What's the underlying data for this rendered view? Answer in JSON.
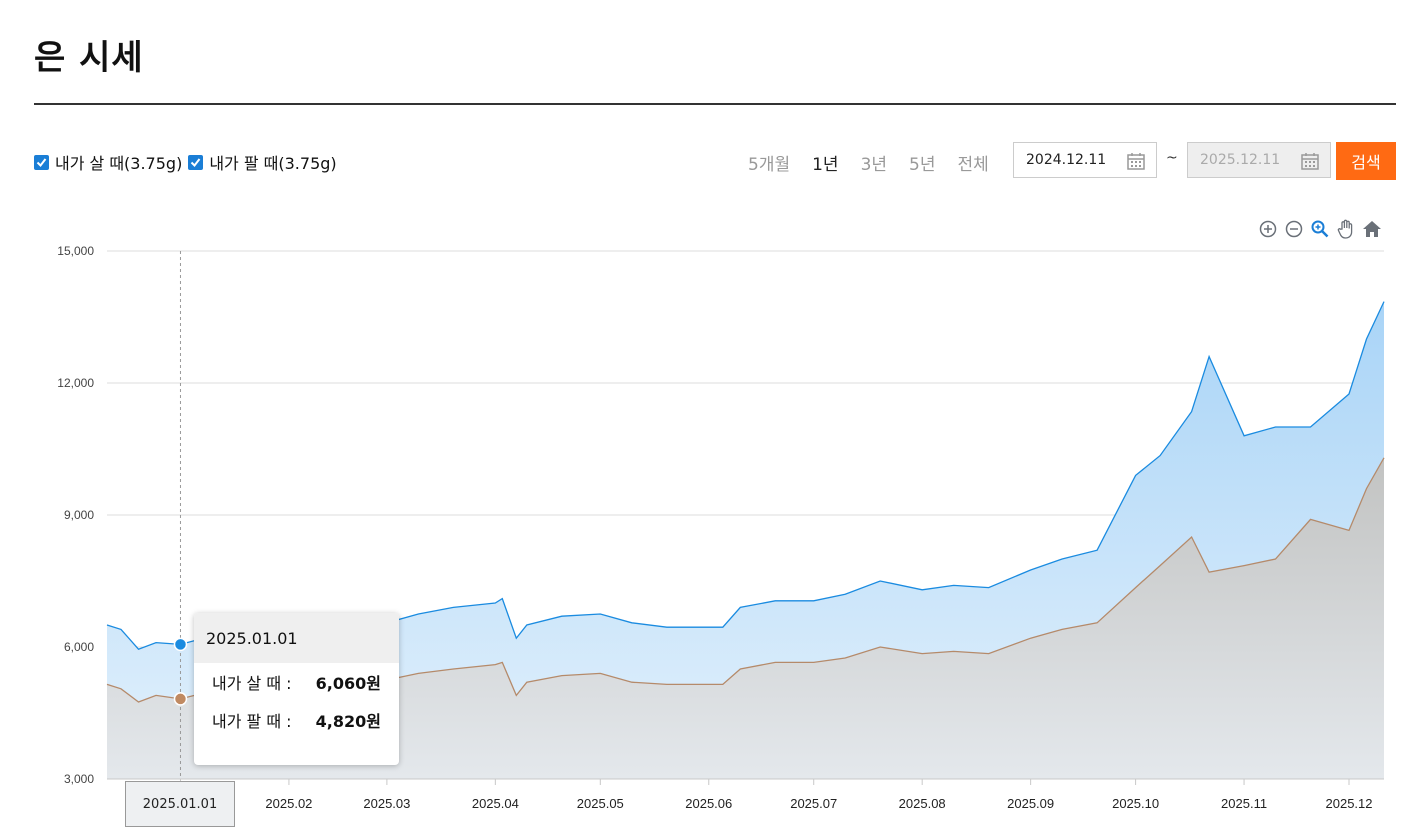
{
  "page": {
    "title": "은 시세"
  },
  "filters": {
    "checkbox_buy": "내가 살 때(3.75g)",
    "checkbox_sell": "내가 팔 때(3.75g)",
    "periods": [
      "5개월",
      "1년",
      "3년",
      "5년",
      "전체"
    ],
    "active_period": "1년",
    "date_from": "2024.12.11",
    "date_separator": "~",
    "date_to": "2025.12.11",
    "search_label": "검색"
  },
  "tooltip": {
    "date": "2025.01.01",
    "buy_label": "내가 살 때 :",
    "buy_value": "6,060원",
    "sell_label": "내가 팔 때 :",
    "sell_value": "4,820원"
  },
  "chart_data": {
    "type": "area",
    "title": "",
    "xlabel": "",
    "ylabel": "",
    "ylim": [
      3000,
      15000
    ],
    "yticks": [
      3000,
      6000,
      9000,
      12000,
      15000
    ],
    "ytick_labels": [
      "3,000",
      "6,000",
      "9,000",
      "12,000",
      "15,000"
    ],
    "xlim": [
      "2024-12-11",
      "2025-12-11"
    ],
    "xticks": [
      "2025-01-01",
      "2025-02-01",
      "2025-03-01",
      "2025-04-01",
      "2025-05-01",
      "2025-06-01",
      "2025-07-01",
      "2025-08-01",
      "2025-09-01",
      "2025-10-01",
      "2025-11-01",
      "2025-12-01"
    ],
    "xtick_labels": [
      "2025.01.01",
      "2025.02",
      "2025.03",
      "2025.04",
      "2025.05",
      "2025.06",
      "2025.07",
      "2025.08",
      "2025.09",
      "2025.10",
      "2025.11",
      "2025.12"
    ],
    "highlight_date": "2025-01-01",
    "grid": true,
    "colors": {
      "buy": "#1a8be0",
      "sell": "#b58a6a",
      "buy_fill": "#a9d4f7",
      "sell_fill": "#d9d7d4"
    },
    "series": [
      {
        "name": "내가 살 때(3.75g)",
        "x": [
          "2024-12-11",
          "2024-12-15",
          "2024-12-20",
          "2024-12-25",
          "2025-01-01",
          "2025-01-10",
          "2025-01-20",
          "2025-02-01",
          "2025-02-10",
          "2025-02-20",
          "2025-03-01",
          "2025-03-10",
          "2025-03-20",
          "2025-04-01",
          "2025-04-03",
          "2025-04-07",
          "2025-04-10",
          "2025-04-20",
          "2025-05-01",
          "2025-05-10",
          "2025-05-20",
          "2025-06-01",
          "2025-06-05",
          "2025-06-10",
          "2025-06-20",
          "2025-07-01",
          "2025-07-10",
          "2025-07-20",
          "2025-08-01",
          "2025-08-10",
          "2025-08-20",
          "2025-09-01",
          "2025-09-10",
          "2025-09-20",
          "2025-10-01",
          "2025-10-08",
          "2025-10-17",
          "2025-10-22",
          "2025-11-01",
          "2025-11-10",
          "2025-11-20",
          "2025-12-01",
          "2025-12-06",
          "2025-12-11"
        ],
        "values": [
          6500,
          6400,
          5950,
          6100,
          6060,
          6250,
          6200,
          6200,
          6350,
          6550,
          6550,
          6750,
          6900,
          7000,
          7100,
          6200,
          6500,
          6700,
          6750,
          6550,
          6450,
          6450,
          6450,
          6900,
          7050,
          7050,
          7200,
          7500,
          7300,
          7400,
          7350,
          7750,
          8000,
          8200,
          9900,
          10350,
          11350,
          12600,
          10800,
          11000,
          11000,
          11750,
          13000,
          13850
        ]
      },
      {
        "name": "내가 팔 때(3.75g)",
        "x": [
          "2024-12-11",
          "2024-12-15",
          "2024-12-20",
          "2024-12-25",
          "2025-01-01",
          "2025-01-10",
          "2025-01-20",
          "2025-02-01",
          "2025-02-10",
          "2025-02-20",
          "2025-03-01",
          "2025-03-10",
          "2025-03-20",
          "2025-04-01",
          "2025-04-03",
          "2025-04-07",
          "2025-04-10",
          "2025-04-20",
          "2025-05-01",
          "2025-05-10",
          "2025-05-20",
          "2025-06-01",
          "2025-06-05",
          "2025-06-10",
          "2025-06-20",
          "2025-07-01",
          "2025-07-10",
          "2025-07-20",
          "2025-08-01",
          "2025-08-10",
          "2025-08-20",
          "2025-09-01",
          "2025-09-10",
          "2025-09-20",
          "2025-10-01",
          "2025-10-08",
          "2025-10-17",
          "2025-10-22",
          "2025-11-01",
          "2025-11-10",
          "2025-11-20",
          "2025-12-01",
          "2025-12-06",
          "2025-12-11"
        ],
        "values": [
          5150,
          5050,
          4750,
          4900,
          4820,
          5000,
          4950,
          4960,
          5100,
          5250,
          5250,
          5400,
          5500,
          5600,
          5650,
          4900,
          5200,
          5350,
          5400,
          5200,
          5150,
          5150,
          5150,
          5500,
          5650,
          5650,
          5750,
          6000,
          5850,
          5900,
          5850,
          6200,
          6400,
          6550,
          7350,
          7850,
          8500,
          7700,
          7850,
          8000,
          8900,
          8650,
          9600,
          10300
        ]
      }
    ]
  }
}
